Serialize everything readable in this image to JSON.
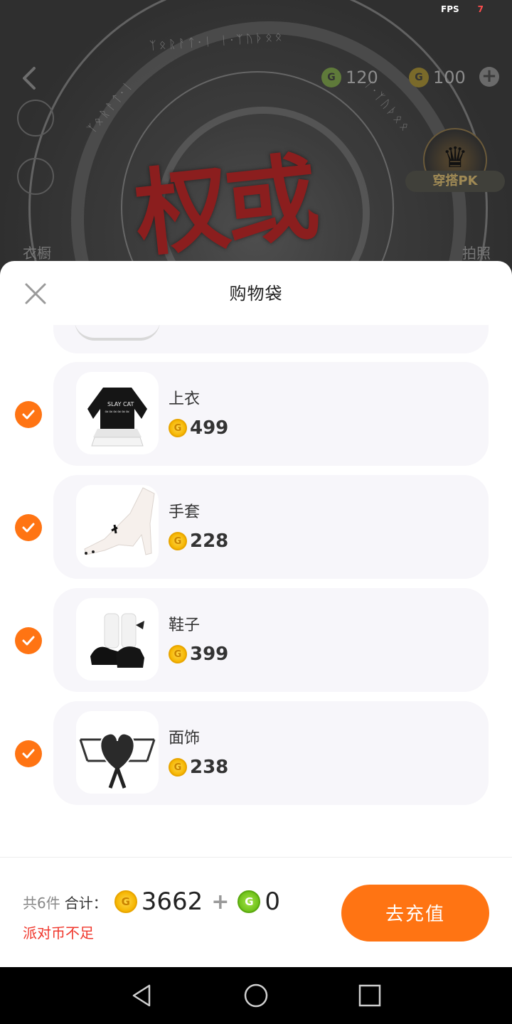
{
  "status": {
    "fps_label": "FPS",
    "fps_value": "7"
  },
  "background": {
    "title_art": "权或",
    "currency_green": "120",
    "currency_gold": "100",
    "pk_label": "穿搭PK",
    "left_label": "衣橱",
    "right_label": "拍照",
    "rune_top": "ᛉᛟᚱᚨᛏ·ᛁ  ᛁ·ᛉᚢᚦᛟᛟ",
    "rune_left": "ᛉᛟᚱᚨᛏ·ᛁ",
    "rune_right": "ᛁ·ᛉᚢᚦᛟᛟ"
  },
  "sheet": {
    "title": "购物袋",
    "items": [
      {
        "name": "上衣",
        "price": "499",
        "checked": true,
        "icon": "top-garment-icon"
      },
      {
        "name": "手套",
        "price": "228",
        "checked": true,
        "icon": "glove-icon"
      },
      {
        "name": "鞋子",
        "price": "399",
        "checked": true,
        "icon": "shoes-icon"
      },
      {
        "name": "面饰",
        "price": "238",
        "checked": true,
        "icon": "face-accessory-icon"
      }
    ]
  },
  "footer": {
    "count": "共6件",
    "total_label": "合计：",
    "total_gold": "3662",
    "plus": "+",
    "total_green": "0",
    "warning": "派对币不足",
    "button_label": "去充值"
  },
  "colors": {
    "accent": "#ff7413",
    "warning": "#f0362b",
    "gold": "#f5b400",
    "green": "#6fc21a"
  }
}
